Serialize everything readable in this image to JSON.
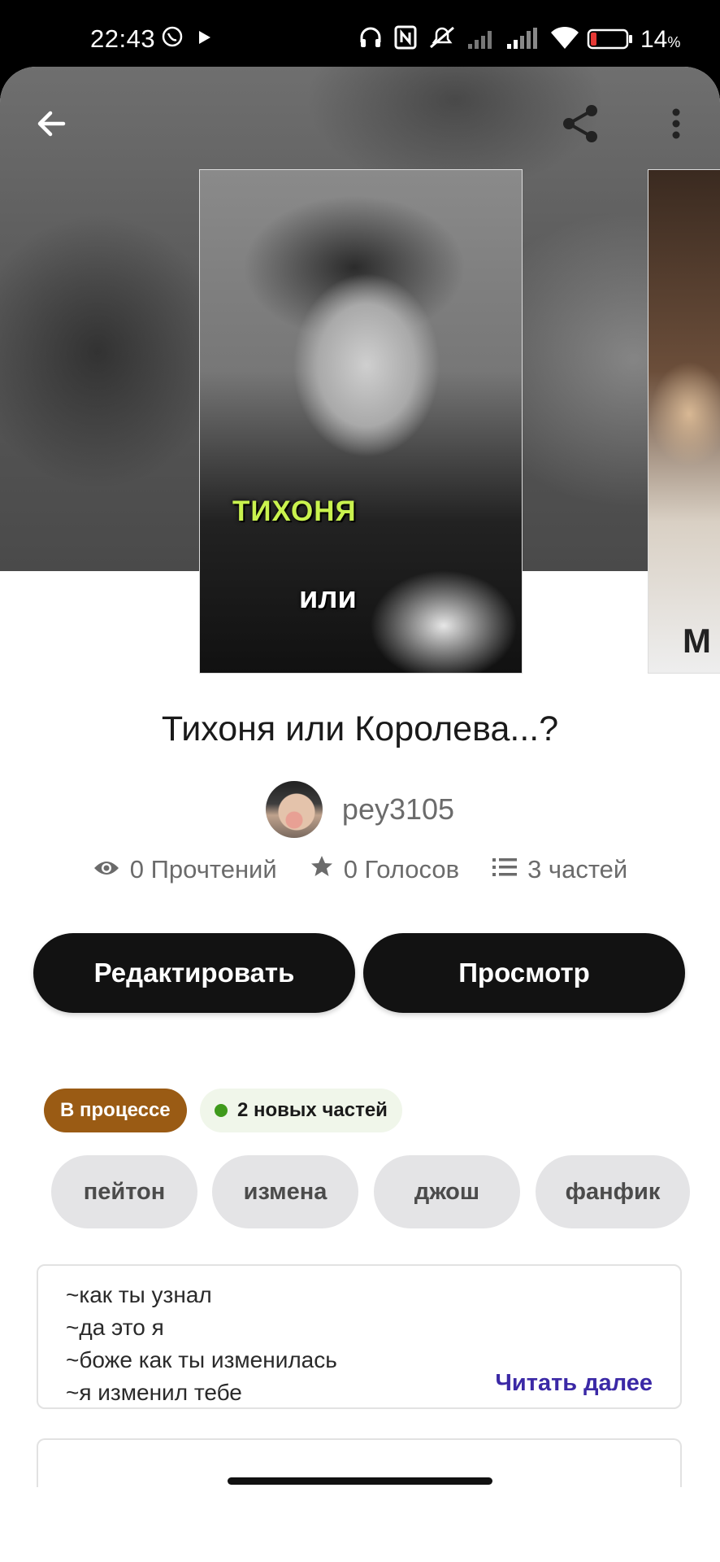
{
  "status_bar": {
    "time": "22:43",
    "battery": "14",
    "battery_unit": "%",
    "battery_level_fraction": 0.14,
    "icons": [
      "viber-icon",
      "play-icon",
      "headphones-icon",
      "nfc-icon",
      "mute-icon",
      "signal-icon",
      "signal-icon",
      "wifi-icon",
      "battery-icon"
    ]
  },
  "toolbar": {
    "icons": [
      "back-arrow-icon",
      "share-icon",
      "more-vertical-icon"
    ]
  },
  "cover": {
    "caption_top": "ТИХОНЯ",
    "caption_bottom": "или",
    "next_cover_partial_text": "M"
  },
  "story": {
    "title": "Тихоня или Королева...?",
    "author": "pey3105",
    "reads": "0 Прочтений",
    "votes": "0 Голосов",
    "parts": "3 частей"
  },
  "actions": {
    "edit_label": "Редактировать",
    "preview_label": "Просмотр"
  },
  "badges": {
    "status": "В процессе",
    "new_parts": "2 новых частей",
    "status_color": "#9a5b14",
    "new_dot_color": "#3f9a1c"
  },
  "tags": [
    "пейтон",
    "измена",
    "джош",
    "фанфик"
  ],
  "description": {
    "lines": [
      "~как ты узнал",
      "~да это я",
      "~боже как ты изменилась",
      "~я изменил тебе"
    ],
    "read_more": "Читать далее",
    "link_color": "#3b29a6"
  }
}
